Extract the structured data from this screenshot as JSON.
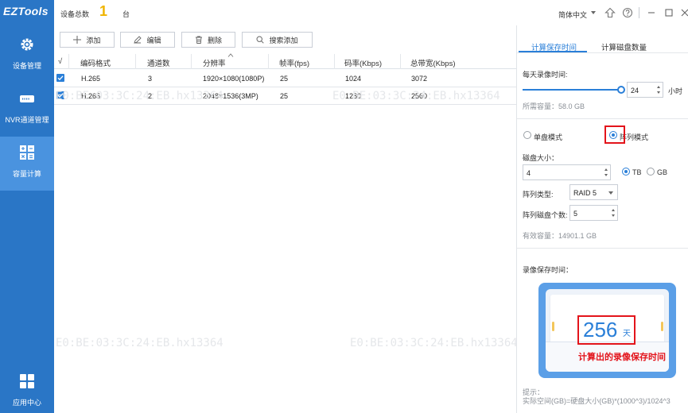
{
  "app": {
    "logo": "EZTools"
  },
  "sidebar": {
    "items": [
      {
        "label": "设备管理",
        "icon": "gear-icon"
      },
      {
        "label": "NVR通道管理",
        "icon": "nvr-device-icon"
      },
      {
        "label": "容量计算",
        "icon": "calculator-icon",
        "active": true
      },
      {
        "label": "应用中心",
        "icon": "app-grid-icon"
      }
    ]
  },
  "header": {
    "device_total_label": "设备总数",
    "device_total_value": "1",
    "device_total_unit": "台",
    "language": "简体中文"
  },
  "toolbar": {
    "add": "添加",
    "edit": "编辑",
    "delete": "删除",
    "search_add": "搜索添加"
  },
  "table": {
    "columns": [
      "√",
      "编码格式",
      "通道数",
      "分辨率",
      "帧率(fps)",
      "码率(Kbps)",
      "总带宽(Kbps)"
    ],
    "rows": [
      {
        "checked": true,
        "codec": "H.265",
        "channels": "3",
        "resolution": "1920×1080(1080P)",
        "fps": "25",
        "bitrate": "1024",
        "bandwidth": "3072"
      },
      {
        "checked": true,
        "codec": "H.265",
        "channels": "2",
        "resolution": "2048×1536(3MP)",
        "fps": "25",
        "bitrate": "1280",
        "bandwidth": "2560"
      }
    ],
    "watermark": "E0:BE:03:3C:24:EB.hx13364"
  },
  "right_panel": {
    "tabs": [
      "计算保存时间",
      "计算磁盘数量"
    ],
    "daily_record_label": "每天录像时间:",
    "daily_record_value": "24",
    "daily_record_unit": "小时",
    "daily_record_fraction": 1.0,
    "required_capacity": "所需容量：58.0 GB",
    "mode_single": "单盘模式",
    "mode_array": "阵列模式",
    "selected_mode": "array",
    "disk_size_label": "磁盘大小：",
    "disk_size_value": "4",
    "unit_tb": "TB",
    "unit_gb": "GB",
    "selected_unit": "TB",
    "array_type_label": "阵列类型:",
    "array_type_value": "RAID 5",
    "array_disk_count_label": "阵列磁盘个数:",
    "array_disk_count_value": "5",
    "effective_capacity": "有效容量：14901.1 GB",
    "retention_label": "录像保存时间：",
    "retention_days": "256",
    "retention_days_unit": "天",
    "retention_caption": "计算出的录像保存时间",
    "hint_title": "提示：",
    "hint_text": "实际空间(GB)=硬盘大小(GB)*(1000^3)/1024^3"
  },
  "colors": {
    "sidebar": "#2a76c6",
    "sidebar_active": "#4a93df",
    "accent": "#2a7fd8",
    "count": "#f0b400",
    "annotation_red": "#e3141b"
  }
}
